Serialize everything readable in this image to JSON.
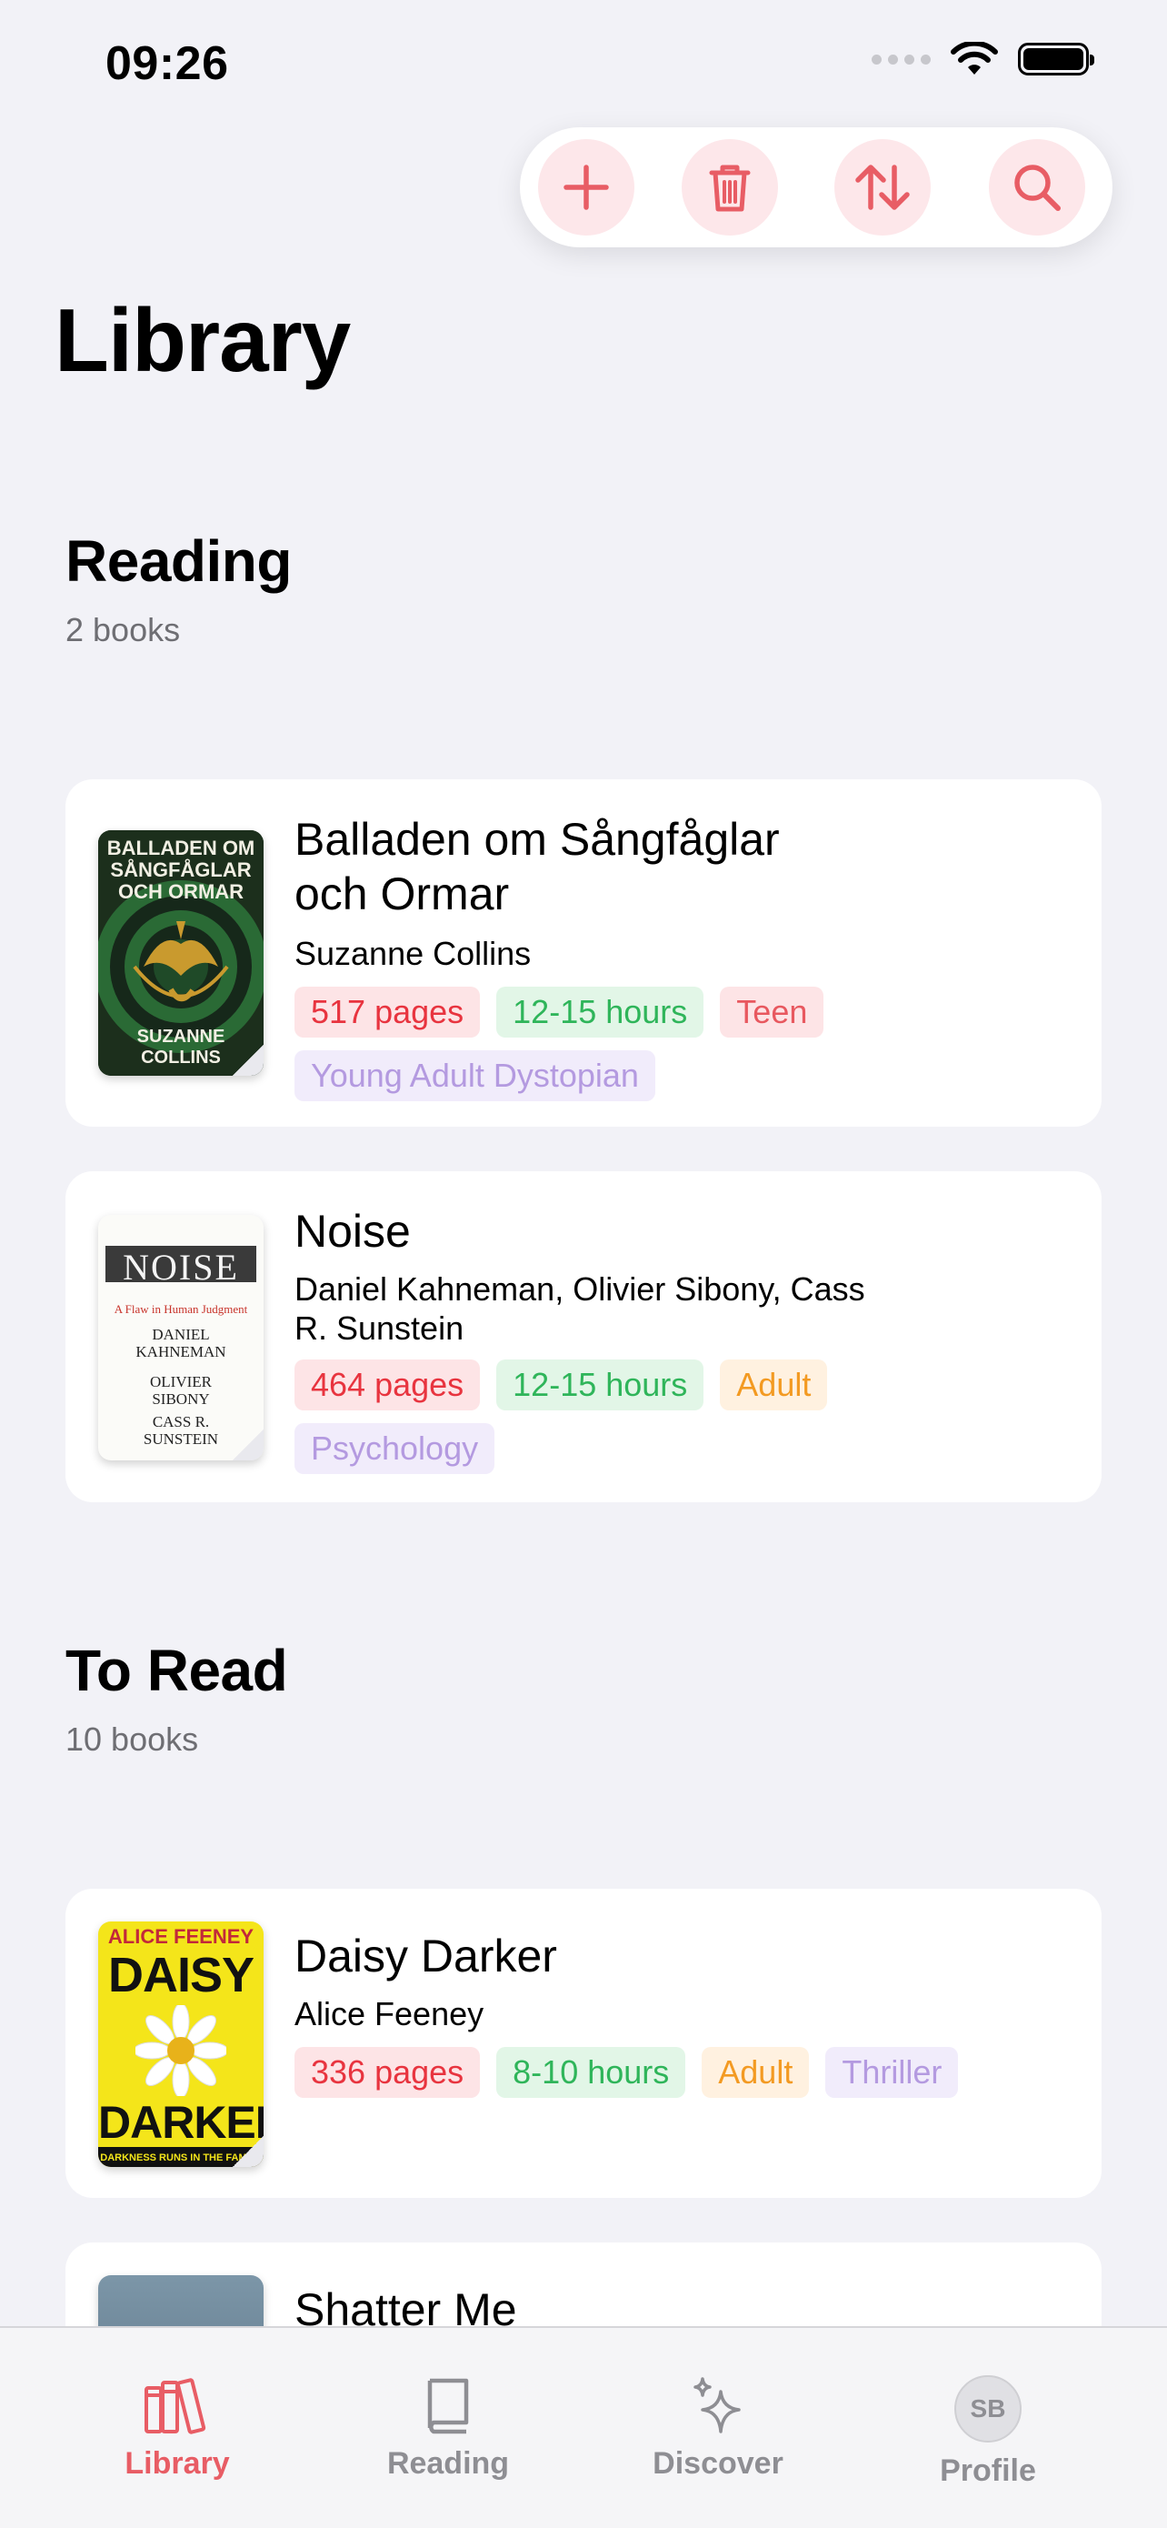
{
  "status_bar": {
    "time": "09:26"
  },
  "header": {
    "title": "Library"
  },
  "toolbar": {
    "buttons": [
      "plus-icon",
      "trash-icon",
      "sort-icon",
      "search-icon"
    ],
    "accent": "#e85d65"
  },
  "sections": [
    {
      "title": "Reading",
      "count": "2 books",
      "books": [
        {
          "title_line1": "Balladen om Sångfåglar",
          "title_line2": "och Ormar",
          "author": "Suzanne Collins",
          "cover_text_top": "BALLADEN OM SÅNGFÅGLAR OCH ORMAR",
          "cover_text_bottom": "SUZANNE COLLINS",
          "tags": {
            "pages": "517 pages",
            "hours": "12-15 hours",
            "age": "Teen",
            "genre": "Young Adult Dystopian"
          }
        },
        {
          "title": "Noise",
          "author_line1": "Daniel Kahneman, Olivier Sibony, Cass",
          "author_line2": "R. Sunstein",
          "cover_title": "NOISE",
          "cover_subtitle": "A Flaw in Human Judgment",
          "cover_authors": [
            "DANIEL",
            "KAHNEMAN",
            "OLIVIER",
            "SIBONY",
            "CASS R.",
            "SUNSTEIN"
          ],
          "tags": {
            "pages": "464 pages",
            "hours": "12-15 hours",
            "age": "Adult",
            "genre": "Psychology"
          }
        }
      ]
    },
    {
      "title": "To Read",
      "count": "10 books",
      "books": [
        {
          "title": "Daisy Darker",
          "author": "Alice Feeney",
          "cover_author": "ALICE FEENEY",
          "cover_word1": "DAISY",
          "cover_word2": "DARKER",
          "cover_tagline": "DARKNESS RUNS IN THE FAMILY",
          "tags": {
            "pages": "336 pages",
            "hours": "8-10 hours",
            "age": "Adult",
            "genre": "Thriller"
          }
        },
        {
          "title": "Shatter Me"
        }
      ]
    }
  ],
  "tabbar": {
    "tabs": [
      {
        "label": "Library",
        "icon": "books-icon",
        "active": true
      },
      {
        "label": "Reading",
        "icon": "book-icon"
      },
      {
        "label": "Discover",
        "icon": "sparkles-icon"
      },
      {
        "label": "Profile",
        "icon": "avatar",
        "initials": "SB"
      }
    ]
  }
}
